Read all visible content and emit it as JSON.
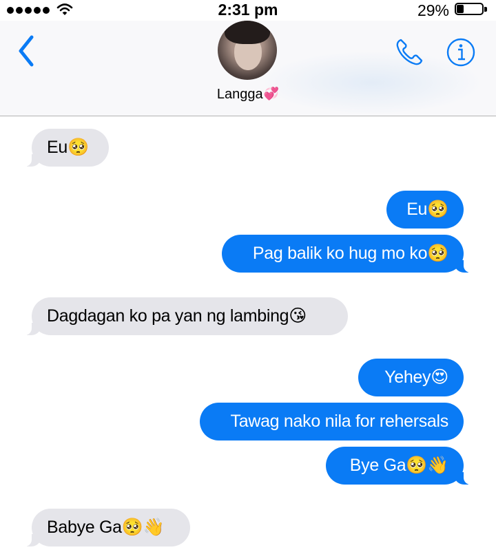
{
  "status_bar": {
    "time": "2:31 pm",
    "battery_percent_label": "29%",
    "battery_level": 0.29,
    "signal_dots": 5
  },
  "header": {
    "contact_name": "Langga",
    "contact_emoji": "💞",
    "back_icon": "chevron-left-icon",
    "call_icon": "phone-icon",
    "info_icon": "info-icon"
  },
  "colors": {
    "accent": "#0a7bf5",
    "incoming_bubble": "#e5e5ea",
    "outgoing_bubble": "#0a7bf5"
  },
  "messages": [
    {
      "direction": "incoming",
      "text": "Eu🥺"
    },
    {
      "direction": "outgoing",
      "text": "Eu🥺"
    },
    {
      "direction": "outgoing",
      "text": "Pag balik ko hug mo ko🥺"
    },
    {
      "direction": "incoming",
      "text": "Dagdagan ko pa yan ng lambing😘"
    },
    {
      "direction": "outgoing",
      "text": "Yehey😍"
    },
    {
      "direction": "outgoing",
      "text": "Tawag nako nila for rehersals"
    },
    {
      "direction": "outgoing",
      "text": "Bye Ga🥺👋"
    },
    {
      "direction": "incoming",
      "text": "Babye Ga🥺👋"
    }
  ]
}
